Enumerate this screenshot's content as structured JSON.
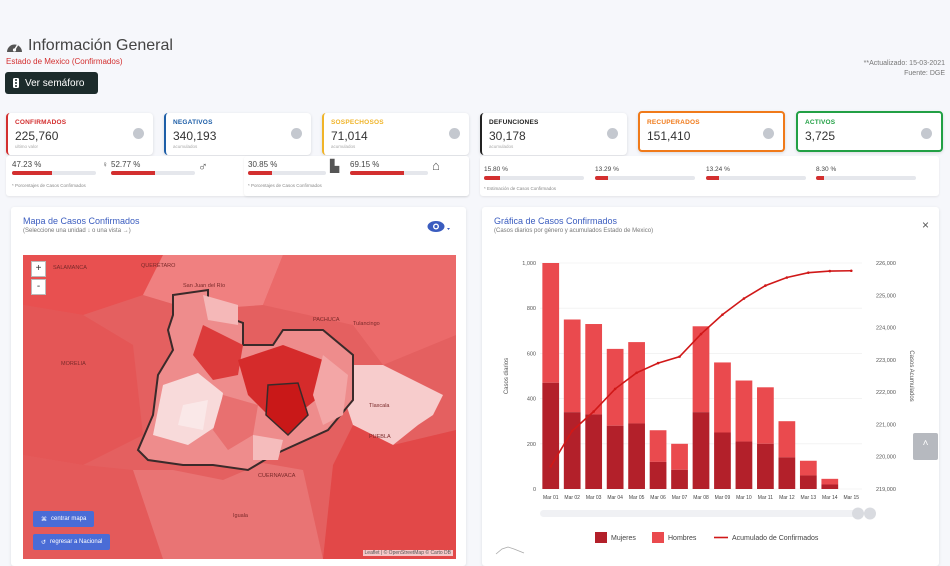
{
  "header": {
    "title": "Información General",
    "subtitle": "Estado de Mexico (Confirmados)",
    "semaforo_button": "Ver semáforo",
    "updated": "**Actualizado: 15-03-2021",
    "source": "Fuente: DGE"
  },
  "cards": [
    {
      "label": "CONFIRMADOS",
      "value": "225,760",
      "sub": "ultimo valor",
      "color": "#d32f2f",
      "icon": "plus-circle-icon"
    },
    {
      "label": "NEGATIVOS",
      "value": "340,193",
      "sub": "acumulados",
      "color": "#1e5fa8",
      "icon": "minus-circle-icon"
    },
    {
      "label": "SOSPECHOSOS",
      "value": "71,014",
      "sub": "acumulados",
      "color": "#f0b429",
      "icon": "question-circle-icon"
    },
    {
      "label": "DEFUNCIONES",
      "value": "30,178",
      "sub": "acumulados",
      "color": "#222222",
      "icon": "person-icon"
    },
    {
      "label": "RECUPERADOS",
      "value": "151,410",
      "sub": "",
      "color": "#f07a1a",
      "icon": "walking-person-icon"
    },
    {
      "label": "ACTIVOS",
      "value": "3,725",
      "sub": "",
      "color": "#22a045",
      "icon": "bed-icon"
    }
  ],
  "strip1": {
    "pct_a": "47.23 %",
    "pct_b": "52.77 %",
    "note": "* Porcentajes de Casos Confirmados",
    "women_fill": 0.4723,
    "men_fill": 0.5277
  },
  "strip2": {
    "pct_a": "30.85 %",
    "pct_b": "69.15 %",
    "note": "* Porcentajes de Casos Confirmados",
    "fill_a": 0.3085,
    "fill_b": 0.6915
  },
  "strip3": {
    "pcts": [
      "15.80 %",
      "13.29 %",
      "13.24 %",
      "8.30 %"
    ],
    "fills": [
      0.158,
      0.1329,
      0.1324,
      0.083
    ],
    "note": "* Estimación de Casos Confirmados"
  },
  "map_panel": {
    "title": "Mapa de Casos Confirmados",
    "subtitle": "(Seleccione una unidad ↓ o una vista →)",
    "zoom_in": "+",
    "zoom_out": "-",
    "center_button": "centrar mapa",
    "national_button": "regresar a Nacional",
    "attribution": "Leaflet | © OpenStreetMap © Carto DB",
    "places": [
      "SALAMANCA",
      "QUERÉTARO",
      "San Juan del Río",
      "PACHUCA",
      "Tulancingo",
      "MORELIA",
      "Tlaxcala",
      "PUEBLA",
      "CUERNAVACA",
      "Iguala"
    ]
  },
  "chart_panel": {
    "title": "Gráfica de Casos Confirmados",
    "subtitle": "(Casos diarios por género y acumulados Estado de Mexico)",
    "close": "×"
  },
  "chart_data": {
    "type": "bar",
    "categories": [
      "Mar 01",
      "Mar 02",
      "Mar 03",
      "Mar 04",
      "Mar 05",
      "Mar 06",
      "Mar 07",
      "Mar 08",
      "Mar 09",
      "Mar 10",
      "Mar 11",
      "Mar 12",
      "Mar 13",
      "Mar 14",
      "Mar 15"
    ],
    "series": [
      {
        "name": "Mujeres",
        "values": [
          470,
          340,
          330,
          280,
          290,
          120,
          85,
          340,
          250,
          210,
          200,
          140,
          60,
          20,
          0
        ],
        "color": "#b3202a"
      },
      {
        "name": "Hombres",
        "values": [
          530,
          410,
          400,
          340,
          360,
          140,
          115,
          380,
          310,
          270,
          250,
          160,
          65,
          25,
          0
        ],
        "color": "#ea4a4e"
      },
      {
        "name": "Acumulado de Confirmados",
        "values": [
          219700,
          220800,
          221400,
          222100,
          222600,
          222900,
          223100,
          223800,
          224400,
          224900,
          225300,
          225550,
          225700,
          225750,
          225760
        ],
        "color": "#d01818"
      }
    ],
    "ylabel": "Casos diarios",
    "y2label": "Casos Acumulados",
    "ylim": [
      0,
      1000
    ],
    "yticks": [
      "0",
      "200",
      "400",
      "600",
      "800",
      "1,000"
    ],
    "y2lim": [
      219000,
      226000
    ],
    "y2ticks": [
      "219,000",
      "220,000",
      "221,000",
      "222,000",
      "223,000",
      "224,000",
      "225,000",
      "226,000"
    ],
    "grid": true,
    "legend": "bottom"
  }
}
